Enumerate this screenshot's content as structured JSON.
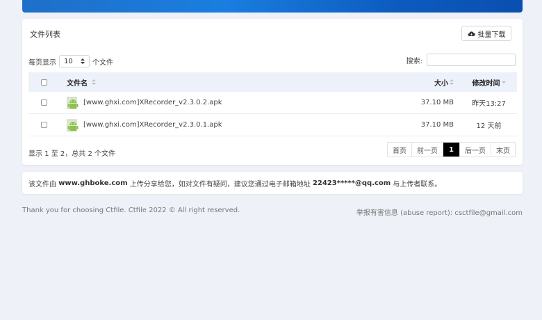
{
  "banner": {
    "text": ""
  },
  "panel": {
    "title": "文件列表",
    "batch_download_label": "批量下载",
    "per_page_prefix": "每页显示",
    "per_page_value": "10",
    "per_page_suffix": "个文件",
    "search_label": "搜索:",
    "search_value": ""
  },
  "table": {
    "headers": {
      "name": "文件名",
      "size": "大小",
      "time": "修改时间"
    },
    "rows": [
      {
        "name": "[www.ghxi.com]XRecorder_v2.3.0.2.apk",
        "size": "37.10 MB",
        "time": "昨天13:27"
      },
      {
        "name": "[www.ghxi.com]XRecorder_v2.3.0.1.apk",
        "size": "37.10 MB",
        "time": "12 天前"
      }
    ]
  },
  "summary": "显示 1 至 2，总共 2 个文件",
  "pagination": {
    "first": "首页",
    "prev": "前一页",
    "current": "1",
    "next": "后一页",
    "last": "末页"
  },
  "notice": {
    "prefix": "该文件由",
    "site": "www.ghboke.com",
    "middle": "上传分享给您，如对文件有疑问，建议您通过电子邮箱地址",
    "email": "22423*****@qq.com",
    "suffix": "与上传者联系。"
  },
  "footer": {
    "left": "Thank you for choosing Ctfile. Ctfile 2022 © All right reserved.",
    "right": "举报有害信息 (abuse report): csctfile@gmail.com"
  },
  "colors": {
    "banner": "#1a7ee0",
    "active_page": "#000000",
    "header_bg": "#edf1f9",
    "apk_green": "#8bc34a"
  }
}
